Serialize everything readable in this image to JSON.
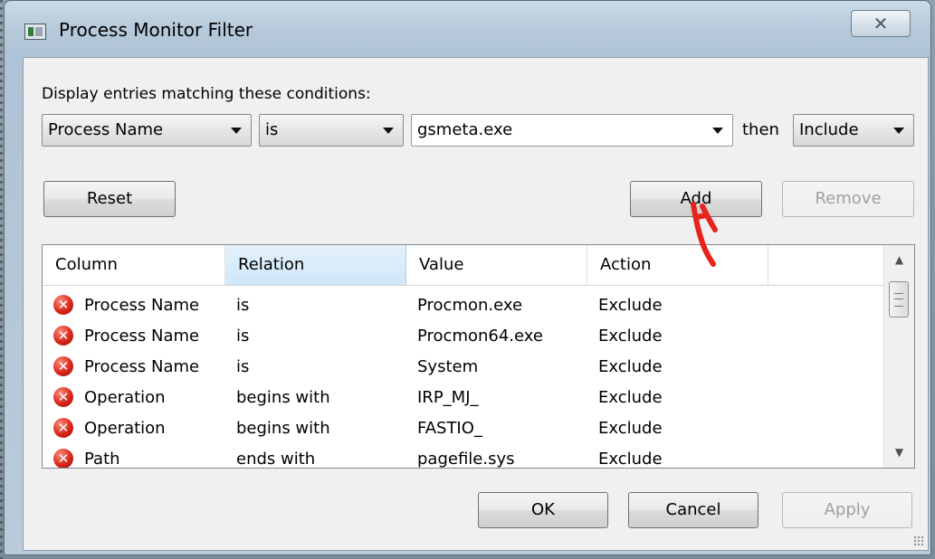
{
  "window": {
    "title": "Process Monitor Filter",
    "close_label": "✕"
  },
  "filter_bar": {
    "prompt": "Display entries matching these conditions:",
    "column_value": "Process Name",
    "relation_value": "is",
    "value_text": "gsmeta.exe",
    "then_label": "then",
    "action_value": "Include"
  },
  "buttons": {
    "reset": "Reset",
    "add": "Add",
    "remove": "Remove",
    "ok": "OK",
    "cancel": "Cancel",
    "apply": "Apply"
  },
  "list": {
    "columns": [
      "Column",
      "Relation",
      "Value",
      "Action"
    ],
    "rows": [
      {
        "column": "Process Name",
        "relation": "is",
        "value": "Procmon.exe",
        "action": "Exclude"
      },
      {
        "column": "Process Name",
        "relation": "is",
        "value": "Procmon64.exe",
        "action": "Exclude"
      },
      {
        "column": "Process Name",
        "relation": "is",
        "value": "System",
        "action": "Exclude"
      },
      {
        "column": "Operation",
        "relation": "begins with",
        "value": "IRP_MJ_",
        "action": "Exclude"
      },
      {
        "column": "Operation",
        "relation": "begins with",
        "value": "FASTIO_",
        "action": "Exclude"
      },
      {
        "column": "Path",
        "relation": "ends with",
        "value": "pagefile.sys",
        "action": "Exclude"
      }
    ]
  },
  "icons": {
    "app": "app-window-icon",
    "rule": "red-x-icon",
    "scroll_up": "▲",
    "scroll_down": "▼"
  },
  "colors": {
    "annotation": "#e8231a",
    "rule_icon": "#d8261a",
    "header_selected": "#cfe7fa"
  }
}
